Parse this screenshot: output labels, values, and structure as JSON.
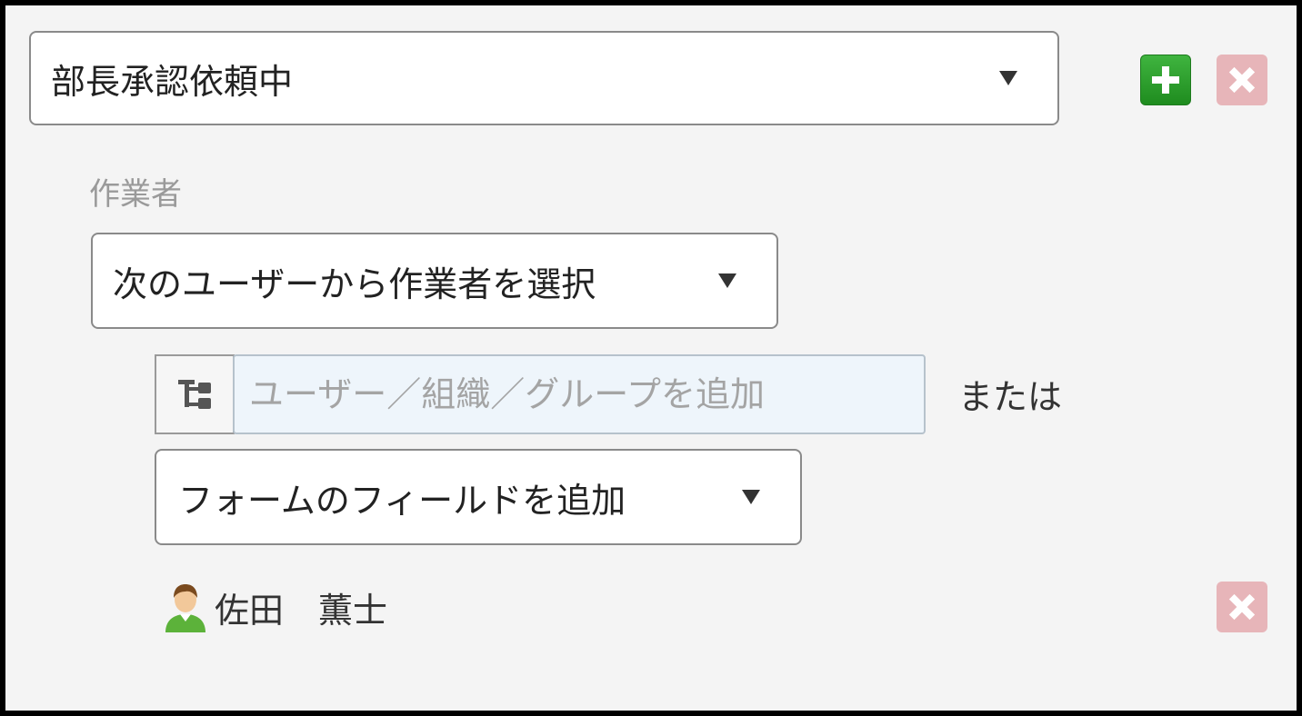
{
  "status_select": {
    "value": "部長承認依頼中"
  },
  "buttons": {
    "add_icon": "plus-icon",
    "delete_icon": "close-icon"
  },
  "worker_section": {
    "label": "作業者",
    "mode_select": {
      "value": "次のユーザーから作業者を選択"
    },
    "org_picker_icon": "org-tree-icon",
    "user_search": {
      "placeholder": "ユーザー／組織／グループを追加",
      "value": ""
    },
    "or_text": "または",
    "field_select": {
      "value": "フォームのフィールドを追加"
    },
    "selected_users": [
      {
        "name": "佐田　薫士",
        "icon": "user-avatar-icon"
      }
    ]
  },
  "colors": {
    "add_button": "#2ea52e",
    "delete_button": "#e7b5b9",
    "panel_background": "#f4f4f4",
    "input_background": "#eef5fb"
  }
}
